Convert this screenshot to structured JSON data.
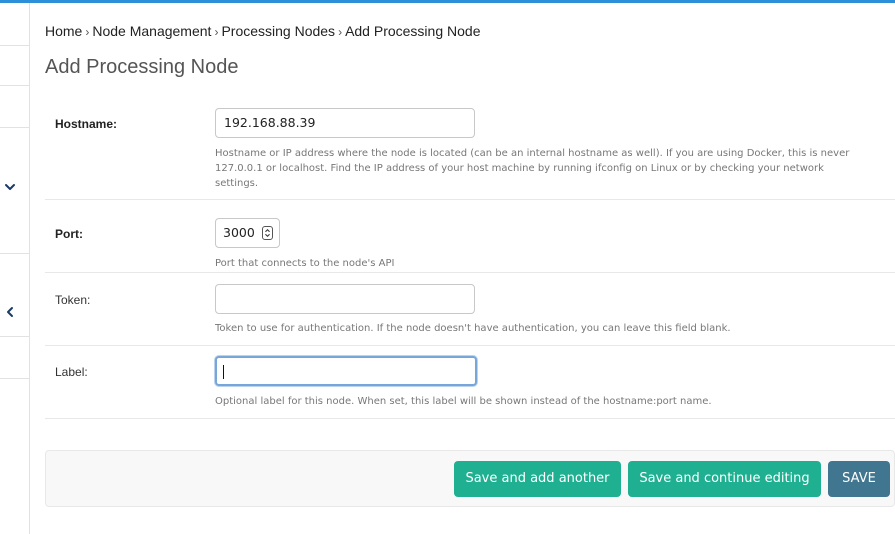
{
  "breadcrumb": {
    "items": [
      "Home",
      "Node Management",
      "Processing Nodes",
      "Add Processing Node"
    ],
    "separator": "›"
  },
  "page": {
    "title": "Add Processing Node"
  },
  "form": {
    "hostname": {
      "label": "Hostname:",
      "value": "192.168.88.39",
      "help": "Hostname or IP address where the node is located (can be an internal hostname as well). If you are using Docker, this is never 127.0.0.1 or localhost. Find the IP address of your host machine by running ifconfig on Linux or by checking your network settings."
    },
    "port": {
      "label": "Port:",
      "value": "3000",
      "help": "Port that connects to the node's API"
    },
    "token": {
      "label": "Token:",
      "value": "",
      "help": "Token to use for authentication. If the node doesn't have authentication, you can leave this field blank."
    },
    "label": {
      "label": "Label:",
      "value": "",
      "help": "Optional label for this node. When set, this label will be shown instead of the hostname:port name."
    }
  },
  "actions": {
    "save_add_another": "Save and add another",
    "save_continue": "Save and continue editing",
    "save": "SAVE"
  },
  "colors": {
    "accent_bar": "#2e8fd9",
    "button_green": "#1fb091",
    "button_blue": "#417690",
    "focus_border": "#79a6d9"
  },
  "icons": {
    "sidebar_expand": "chevron-down-icon",
    "sidebar_collapse": "chevron-left-icon",
    "port_spinner": "spinner-arrows-icon"
  }
}
